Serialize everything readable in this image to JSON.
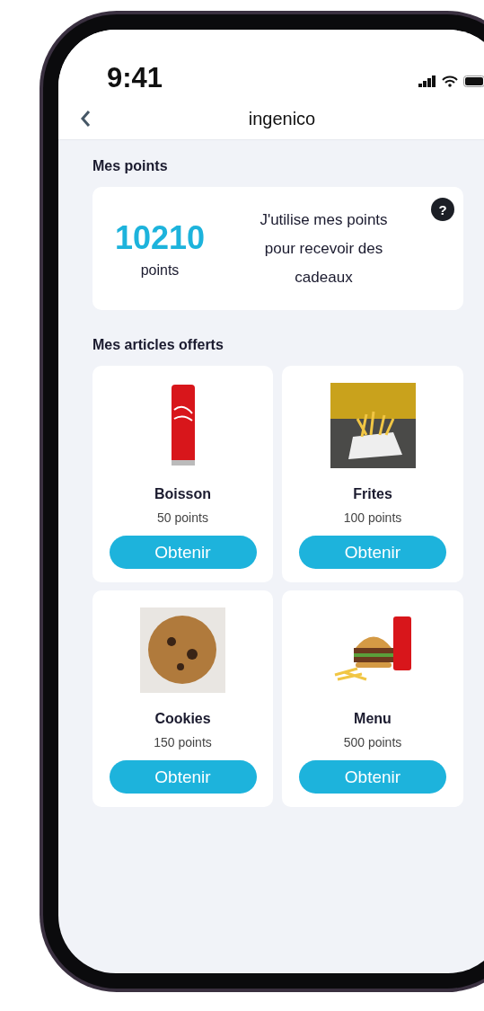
{
  "status_bar": {
    "time": "9:41"
  },
  "nav": {
    "logo": "ingenico"
  },
  "points_section": {
    "title": "Mes points",
    "value": "10210",
    "unit": "points",
    "description": "J'utilise mes points pour recevoir des cadeaux",
    "help": "?"
  },
  "articles_section": {
    "title": "Mes articles offerts",
    "items": [
      {
        "kind": "can",
        "name": "Boisson",
        "cost": "50 points",
        "button": "Obtenir"
      },
      {
        "kind": "fries",
        "name": "Frites",
        "cost": "100 points",
        "button": "Obtenir"
      },
      {
        "kind": "cookie",
        "name": "Cookies",
        "cost": "150 points",
        "button": "Obtenir"
      },
      {
        "kind": "menu",
        "name": "Menu",
        "cost": "500 points",
        "button": "Obtenir"
      }
    ]
  }
}
